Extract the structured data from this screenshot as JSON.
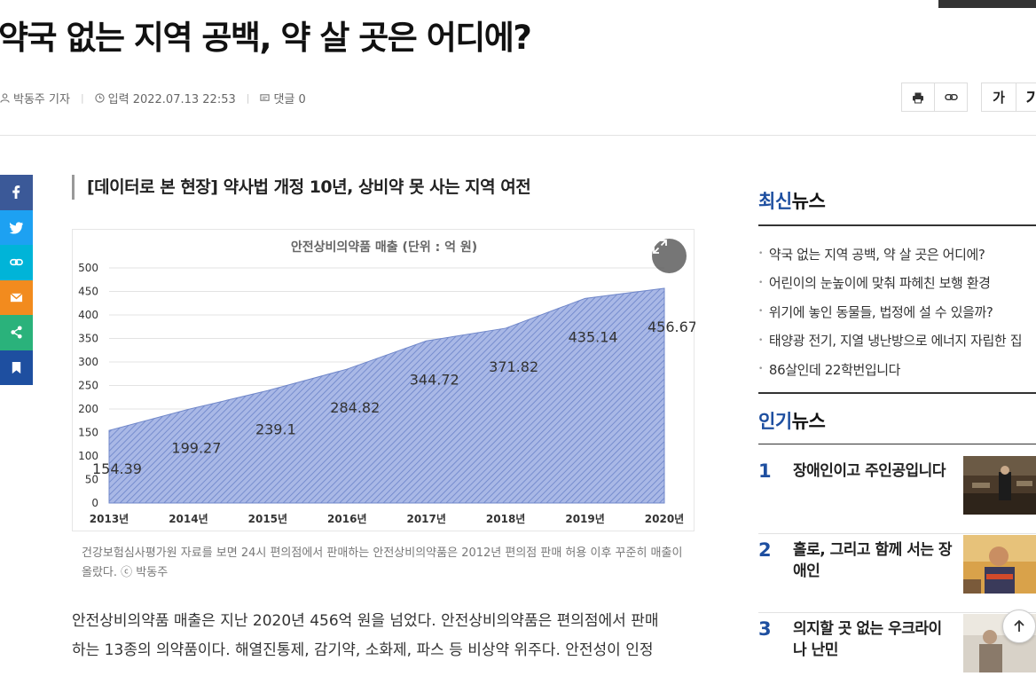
{
  "article": {
    "headline": "약국 없는 지역 공백, 약 살 곳은 어디에?",
    "author": "박동주 기자",
    "date_label": "입력 2022.07.13 22:53",
    "comments_label": "댓글 0",
    "subtitle": "[데이터로 본 현장] 약사법 개정 10년, 상비약 못 사는 지역 여전",
    "caption": "건강보험심사평가원 자료를 보면 24시 편의점에서 판매하는 안전상비의약품은 2012년 편의점 판매 허용 이후 꾸준히 매출이 올랐다. ⓒ 박동주",
    "body_line1": "안전상비의약품 매출은 지난 2020년 456억 원을 넘었다. 안전상비의약품은 편의점에서 판매",
    "body_line2": "하는 13종의 의약품이다. 해열진통제, 감기약, 소화제, 파스 등 비상약 위주다. 안전성이 인정"
  },
  "toolbar": {
    "print_icon": "print-icon",
    "link_icon": "link-icon",
    "font_small": "가",
    "font_large": "가"
  },
  "share": {
    "items": [
      {
        "name": "facebook",
        "color": "#3b5998"
      },
      {
        "name": "twitter",
        "color": "#1da1f2"
      },
      {
        "name": "link",
        "color": "#00b4d8"
      },
      {
        "name": "email",
        "color": "#f28b1e"
      },
      {
        "name": "share",
        "color": "#2ab27b"
      },
      {
        "name": "bookmark",
        "color": "#1e4fa0"
      }
    ]
  },
  "sidebar": {
    "latest_accent": "최신",
    "latest_rest": "뉴스",
    "latest": [
      "약국 없는 지역 공백, 약 살 곳은 어디에?",
      "어린이의 눈높이에 맞춰 파헤친 보행 환경",
      "위기에 놓인 동물들, 법정에 설 수 있을까?",
      "태양광 전기, 지열 냉난방으로 에너지 자립한 집",
      "86살인데 22학번입니다"
    ],
    "popular_accent": "인기",
    "popular_rest": "뉴스",
    "popular": [
      {
        "rank": "1",
        "title": "장애인이고 주인공입니다"
      },
      {
        "rank": "2",
        "title": "홀로, 그리고 함께 서는 장애인"
      },
      {
        "rank": "3",
        "title": "의지할 곳 없는 우크라이나 난민"
      }
    ]
  },
  "chart_data": {
    "type": "area",
    "title": "안전상비의약품 매출 (단위 : 억 원)",
    "categories": [
      "2013년",
      "2014년",
      "2015년",
      "2016년",
      "2017년",
      "2018년",
      "2019년",
      "2020년"
    ],
    "values": [
      154.39,
      199.27,
      239.1,
      284.82,
      344.72,
      371.82,
      435.14,
      456.67
    ],
    "value_labels": [
      "154.39",
      "199.27",
      "239.1",
      "284.82",
      "344.72",
      "371.82",
      "435.14",
      "456.67"
    ],
    "yticks": [
      "0",
      "50",
      "100",
      "150",
      "200",
      "250",
      "300",
      "350",
      "400",
      "450",
      "500"
    ],
    "ylim": [
      0,
      500
    ],
    "grid": true,
    "fill_color": "#8fa3d9",
    "line_color": "#3f5fb3"
  }
}
